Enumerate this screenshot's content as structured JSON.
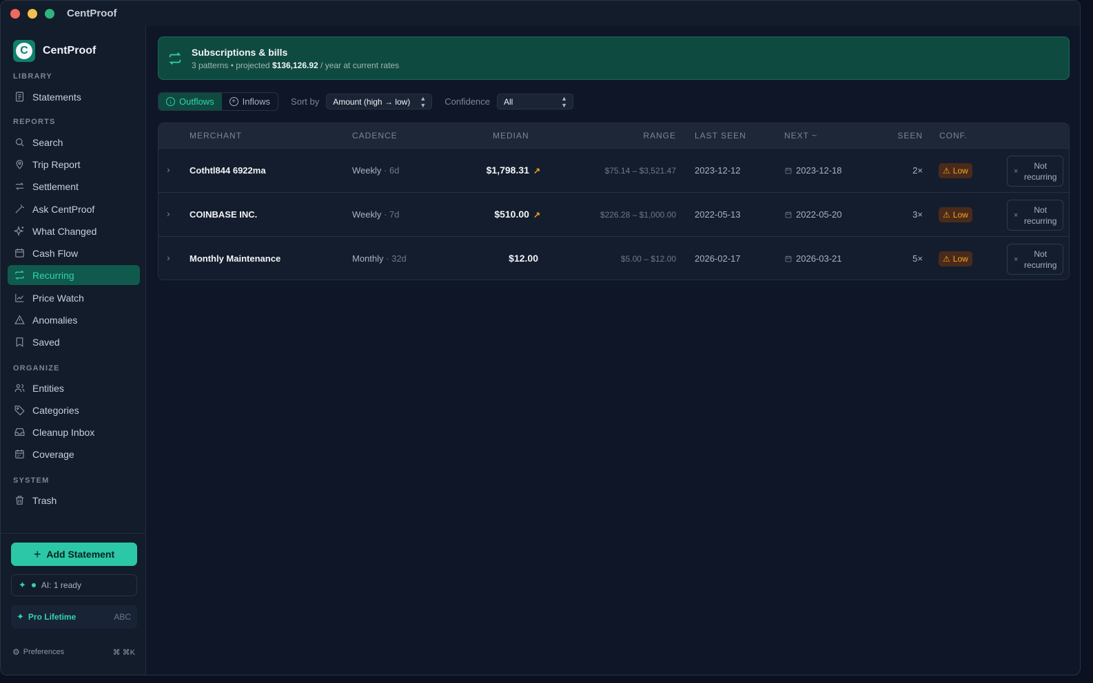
{
  "app": {
    "title": "CentProof",
    "brand": "CentProof",
    "brand_logo_letter": "C"
  },
  "sidebar": {
    "sections": [
      {
        "label": "LIBRARY"
      },
      {
        "label": "REPORTS"
      },
      {
        "label": "ORGANIZE"
      },
      {
        "label": "SYSTEM"
      }
    ],
    "items": [
      {
        "label": "Statements",
        "icon": "document-icon"
      },
      {
        "label": "Search",
        "icon": "search-icon"
      },
      {
        "label": "Trip Report",
        "icon": "map-pin-icon"
      },
      {
        "label": "Settlement",
        "icon": "arrows-exchange-icon"
      },
      {
        "label": "Ask CentProof",
        "icon": "magic-wand-icon"
      },
      {
        "label": "What Changed",
        "icon": "sparkle-icon"
      },
      {
        "label": "Cash Flow",
        "icon": "calendar-icon"
      },
      {
        "label": "Recurring",
        "icon": "repeat-icon",
        "active": true
      },
      {
        "label": "Price Watch",
        "icon": "line-chart-icon"
      },
      {
        "label": "Anomalies",
        "icon": "warning-icon"
      },
      {
        "label": "Saved",
        "icon": "bookmark-icon"
      },
      {
        "label": "Entities",
        "icon": "users-icon"
      },
      {
        "label": "Categories",
        "icon": "tag-icon"
      },
      {
        "label": "Cleanup Inbox",
        "icon": "inbox-icon"
      },
      {
        "label": "Coverage",
        "icon": "calendar-grid-icon"
      },
      {
        "label": "Trash",
        "icon": "trash-icon"
      }
    ],
    "add_statement": "Add Statement",
    "ai_status": "AI: 1 ready",
    "plan": {
      "label": "Pro Lifetime",
      "code": "ABC"
    },
    "preferences": {
      "label": "Preferences",
      "shortcut": "⌘ ⌘K"
    }
  },
  "banner": {
    "title": "Subscriptions & bills",
    "sub_prefix": "3 patterns • projected",
    "amount": "$136,126.92",
    "sub_suffix": "/ year at current rates"
  },
  "toolbar": {
    "outflows": "Outflows",
    "inflows": "Inflows",
    "sort_label": "Sort by",
    "sort_value": "Amount (high → low)",
    "confidence_label": "Confidence",
    "confidence_value": "All"
  },
  "table": {
    "headers": {
      "merchant": "MERCHANT",
      "cadence": "CADENCE",
      "median": "MEDIAN",
      "range": "RANGE",
      "last_seen": "LAST SEEN",
      "next": "NEXT ~",
      "seen": "SEEN",
      "conf": "CONF."
    },
    "rows": [
      {
        "merchant": "Cothtl844 6922ma",
        "cadence": "Weekly",
        "cadence_days": "· 6d",
        "median": "$1,798.31",
        "trend": true,
        "range": "$75.14 – $3,521.47",
        "last_seen": "2023-12-12",
        "next": "2023-12-18",
        "seen": "2×",
        "conf": "Low",
        "action_line1": "Not",
        "action_line2": "recurring"
      },
      {
        "merchant": "COINBASE INC.",
        "cadence": "Weekly",
        "cadence_days": "· 7d",
        "median": "$510.00",
        "trend": true,
        "range": "$226.28 – $1,000.00",
        "last_seen": "2022-05-13",
        "next": "2022-05-20",
        "seen": "3×",
        "conf": "Low",
        "action_line1": "Not",
        "action_line2": "recurring"
      },
      {
        "merchant": "Monthly Maintenance",
        "cadence": "Monthly",
        "cadence_days": "· 32d",
        "median": "$12.00",
        "trend": false,
        "range": "$5.00 – $12.00",
        "last_seen": "2026-02-17",
        "next": "2026-03-21",
        "seen": "5×",
        "conf": "Low",
        "action_line1": "Not",
        "action_line2": "recurring"
      }
    ]
  },
  "colors": {
    "accent": "#34d3b0",
    "warning": "#f5a623",
    "background": "#0e1627"
  }
}
